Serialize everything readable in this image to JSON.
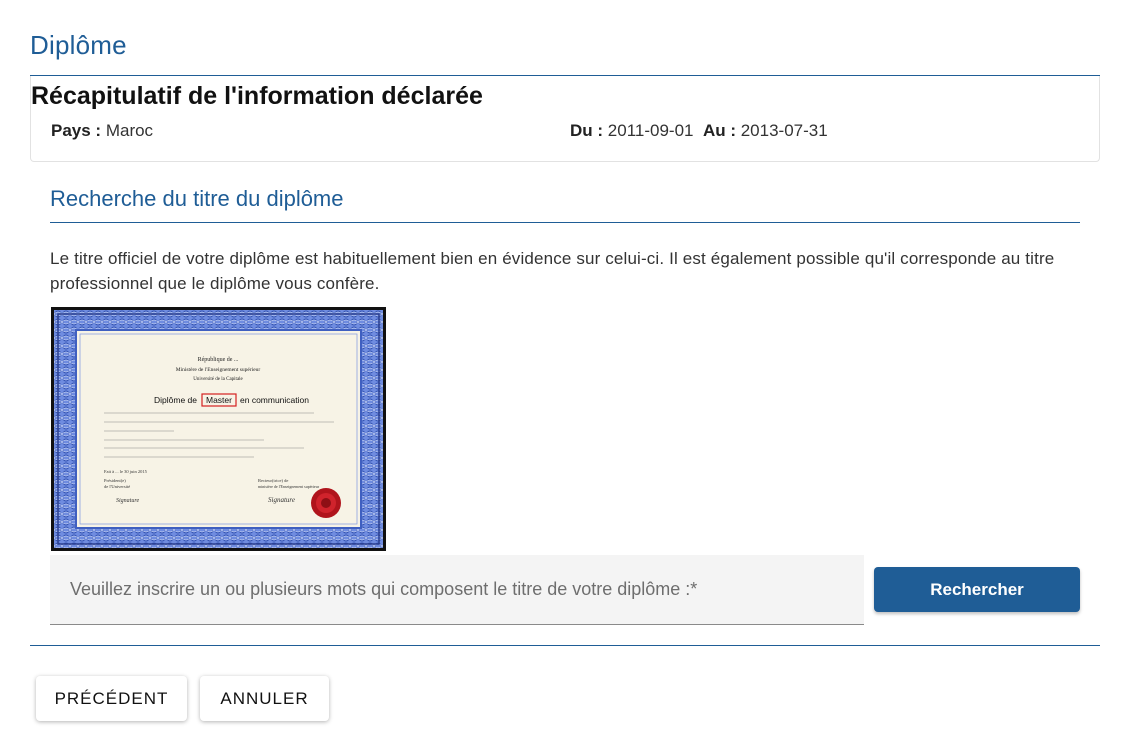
{
  "header": {
    "title": "Diplôme"
  },
  "summary": {
    "title": "Récapitulatif de l'information déclarée",
    "pays_label": "Pays :",
    "pays_value": "Maroc",
    "du_label": "Du :",
    "du_value": "2011-09-01",
    "au_label": "Au :",
    "au_value": "2013-07-31"
  },
  "search_section": {
    "title": "Recherche du titre du diplôme",
    "description": "Le titre officiel de votre diplôme est habituellement bien en évidence sur celui-ci. Il est également possible qu'il corresponde au titre professionnel que le diplôme vous confère.",
    "input_placeholder": "Veuillez inscrire un ou plusieurs mots qui composent le titre de votre diplôme :*",
    "input_value": "",
    "search_button": "Rechercher"
  },
  "diploma_image": {
    "line1": "République de ...",
    "line2": "Ministère de l'Enseignement supérieur",
    "line3": "Université de la Capitale",
    "title_before": "Diplôme de",
    "title_highlight": "Master",
    "title_after": "en communication",
    "place_date": "Fait à ... le 30 juin 2015",
    "left_sign_1": "Président(e)",
    "left_sign_2": "de l'Université",
    "right_sign_1": "Recteur(trice) de",
    "right_sign_2": "ministère de l'Enseignement supérieur",
    "signature_left": "Signature",
    "signature_right": "Signature",
    "highlight_color": "#d42020",
    "border_color": "#3f5fc0",
    "seal_color": "#b0141c"
  },
  "footer": {
    "previous_button": "PRÉCÉDENT",
    "cancel_button": "ANNULER"
  }
}
